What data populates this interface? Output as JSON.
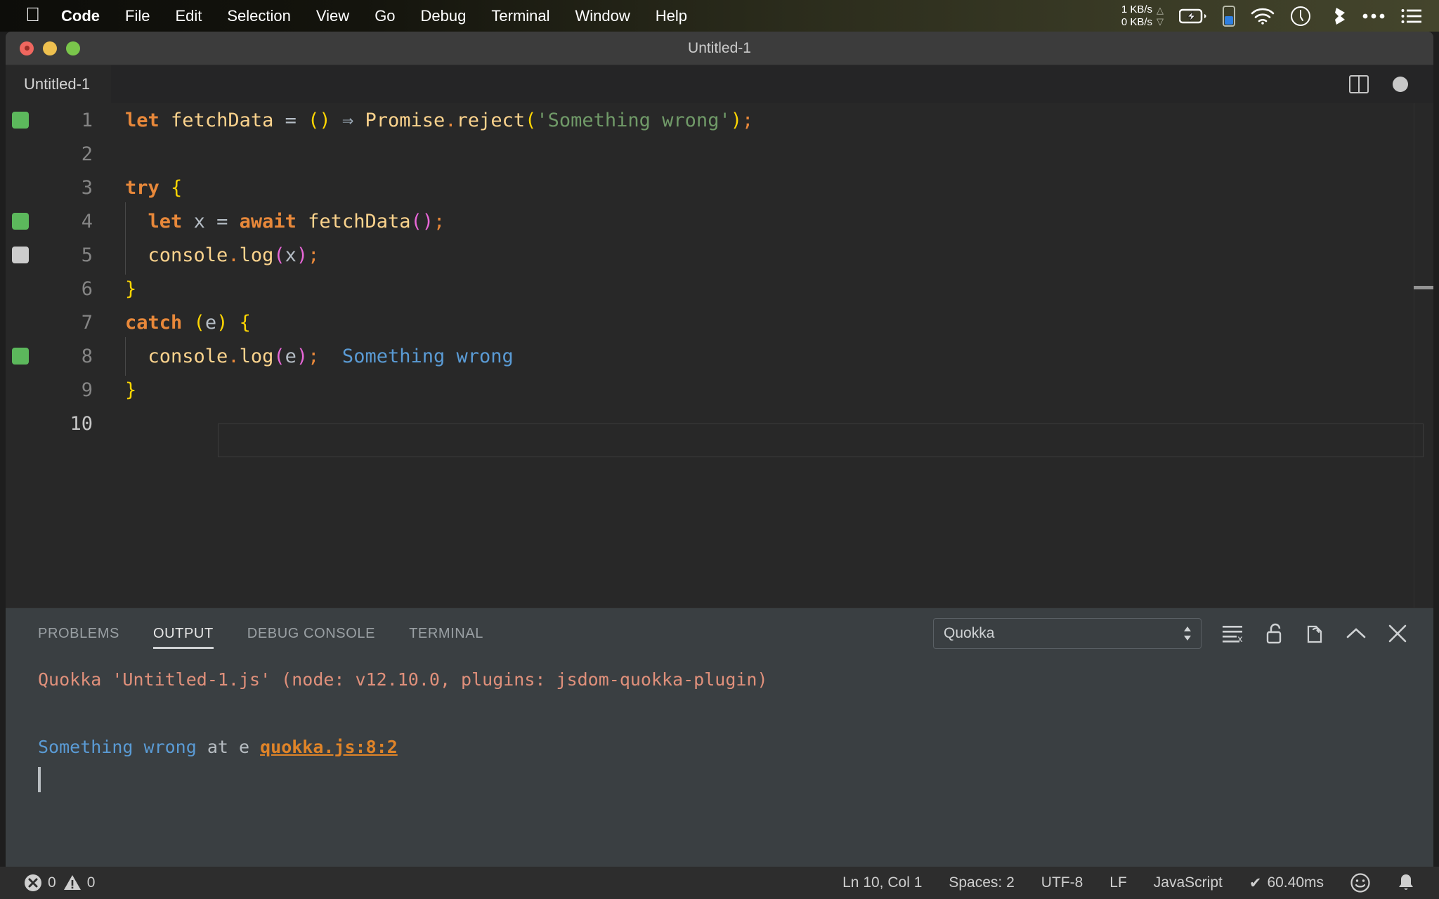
{
  "menubar": {
    "apple_icon": "apple-logo-icon",
    "items": [
      {
        "label": "Code",
        "bold": true
      },
      {
        "label": "File",
        "bold": false
      },
      {
        "label": "Edit",
        "bold": false
      },
      {
        "label": "Selection",
        "bold": false
      },
      {
        "label": "View",
        "bold": false
      },
      {
        "label": "Go",
        "bold": false
      },
      {
        "label": "Debug",
        "bold": false
      },
      {
        "label": "Terminal",
        "bold": false
      },
      {
        "label": "Window",
        "bold": false
      },
      {
        "label": "Help",
        "bold": false
      }
    ],
    "network": {
      "up": "1 KB/s",
      "down": "0 KB/s",
      "up_arrow": "△",
      "down_arrow": "▽"
    },
    "status_icons": [
      "battery-charging-icon",
      "phone-battery-icon",
      "wifi-icon",
      "clock-icon",
      "dropbox-icon",
      "ellipsis-icon",
      "menu-list-icon"
    ]
  },
  "window": {
    "title": "Untitled-1",
    "traffic_lights": [
      "close-button",
      "minimize-button",
      "maximize-button"
    ]
  },
  "editor": {
    "tab_label": "Untitled-1",
    "actions": [
      "split-editor-icon",
      "unsaved-dot-indicator"
    ],
    "cursor_position": "Ln 10, Col 1",
    "lines": [
      {
        "number": "1",
        "marker": "green",
        "indent_guide": false,
        "tokens": [
          {
            "t": "let",
            "c": "kw"
          },
          {
            "t": " ",
            "c": "plain"
          },
          {
            "t": "fetchData",
            "c": "fn"
          },
          {
            "t": " ",
            "c": "plain"
          },
          {
            "t": "=",
            "c": "plain"
          },
          {
            "t": " ",
            "c": "plain"
          },
          {
            "t": "(",
            "c": "br-y"
          },
          {
            "t": ")",
            "c": "br-y"
          },
          {
            "t": " ",
            "c": "plain"
          },
          {
            "t": "⇒",
            "c": "arrow"
          },
          {
            "t": " ",
            "c": "plain"
          },
          {
            "t": "Promise",
            "c": "fn"
          },
          {
            "t": ".",
            "c": "punc"
          },
          {
            "t": "reject",
            "c": "fn"
          },
          {
            "t": "(",
            "c": "br-y"
          },
          {
            "t": "'Something wrong'",
            "c": "str"
          },
          {
            "t": ")",
            "c": "br-y"
          },
          {
            "t": ";",
            "c": "punc"
          }
        ]
      },
      {
        "number": "2",
        "marker": "",
        "indent_guide": false,
        "tokens": []
      },
      {
        "number": "3",
        "marker": "",
        "indent_guide": false,
        "tokens": [
          {
            "t": "try",
            "c": "kw"
          },
          {
            "t": " ",
            "c": "plain"
          },
          {
            "t": "{",
            "c": "br-y"
          }
        ]
      },
      {
        "number": "4",
        "marker": "green",
        "indent_guide": true,
        "tokens": [
          {
            "t": "  ",
            "c": "plain"
          },
          {
            "t": "let",
            "c": "kw"
          },
          {
            "t": " ",
            "c": "plain"
          },
          {
            "t": "x",
            "c": "plain"
          },
          {
            "t": " ",
            "c": "plain"
          },
          {
            "t": "=",
            "c": "plain"
          },
          {
            "t": " ",
            "c": "plain"
          },
          {
            "t": "await",
            "c": "kw"
          },
          {
            "t": " ",
            "c": "plain"
          },
          {
            "t": "fetchData",
            "c": "fn"
          },
          {
            "t": "(",
            "c": "br-m"
          },
          {
            "t": ")",
            "c": "br-m"
          },
          {
            "t": ";",
            "c": "punc"
          }
        ]
      },
      {
        "number": "5",
        "marker": "gray",
        "indent_guide": true,
        "tokens": [
          {
            "t": "  ",
            "c": "plain"
          },
          {
            "t": "console",
            "c": "fn"
          },
          {
            "t": ".",
            "c": "punc"
          },
          {
            "t": "log",
            "c": "fn"
          },
          {
            "t": "(",
            "c": "br-m"
          },
          {
            "t": "x",
            "c": "plain"
          },
          {
            "t": ")",
            "c": "br-m"
          },
          {
            "t": ";",
            "c": "punc"
          }
        ]
      },
      {
        "number": "6",
        "marker": "",
        "indent_guide": false,
        "tokens": [
          {
            "t": "}",
            "c": "br-y"
          }
        ]
      },
      {
        "number": "7",
        "marker": "",
        "indent_guide": false,
        "tokens": [
          {
            "t": "catch",
            "c": "kw"
          },
          {
            "t": " ",
            "c": "plain"
          },
          {
            "t": "(",
            "c": "br-y"
          },
          {
            "t": "e",
            "c": "plain"
          },
          {
            "t": ")",
            "c": "br-y"
          },
          {
            "t": " ",
            "c": "plain"
          },
          {
            "t": "{",
            "c": "br-y"
          }
        ]
      },
      {
        "number": "8",
        "marker": "green",
        "indent_guide": true,
        "tokens": [
          {
            "t": "  ",
            "c": "plain"
          },
          {
            "t": "console",
            "c": "fn"
          },
          {
            "t": ".",
            "c": "punc"
          },
          {
            "t": "log",
            "c": "fn"
          },
          {
            "t": "(",
            "c": "br-m"
          },
          {
            "t": "e",
            "c": "plain"
          },
          {
            "t": ")",
            "c": "br-m"
          },
          {
            "t": ";",
            "c": "punc"
          },
          {
            "t": "  Something wrong",
            "c": "quokka"
          }
        ]
      },
      {
        "number": "9",
        "marker": "",
        "indent_guide": false,
        "tokens": [
          {
            "t": "}",
            "c": "br-y"
          }
        ]
      },
      {
        "number": "10",
        "marker": "",
        "indent_guide": false,
        "active": true,
        "tokens": []
      }
    ]
  },
  "panel": {
    "tabs": [
      {
        "label": "PROBLEMS",
        "active": false
      },
      {
        "label": "OUTPUT",
        "active": true
      },
      {
        "label": "DEBUG CONSOLE",
        "active": false
      },
      {
        "label": "TERMINAL",
        "active": false
      }
    ],
    "channel_selected": "Quokka",
    "actions": [
      "clear-output-icon",
      "unlock-scroll-icon",
      "open-in-editor-icon",
      "maximize-panel-icon",
      "close-panel-icon"
    ],
    "output": {
      "line1": "Quokka 'Untitled-1.js' (node: v12.10.0, plugins: jsdom-quokka-plugin)",
      "line2_message": "Something wrong",
      "line2_at": " at e ",
      "line2_link": "quokka.js:8:2"
    }
  },
  "statusbar": {
    "errors": "0",
    "warnings": "0",
    "cursor": "Ln 10, Col 1",
    "spaces": "Spaces: 2",
    "encoding": "UTF-8",
    "eol": "LF",
    "language": "JavaScript",
    "quokka_time": "60.40ms",
    "quokka_check": "✔",
    "right_icons": [
      "feedback-smiley-icon",
      "notifications-bell-icon"
    ]
  },
  "colors": {
    "menubar_accent": "#44452c",
    "editor_bg": "#282828",
    "panel_bg": "#3a3f42",
    "statusbar_bg": "#2d2d2d",
    "marker_green": "#5cb85c",
    "marker_gray": "#cccccc",
    "quokka_blue": "#5a9bd5",
    "output_salmon": "#e0907b",
    "link_orange": "#e08428"
  }
}
